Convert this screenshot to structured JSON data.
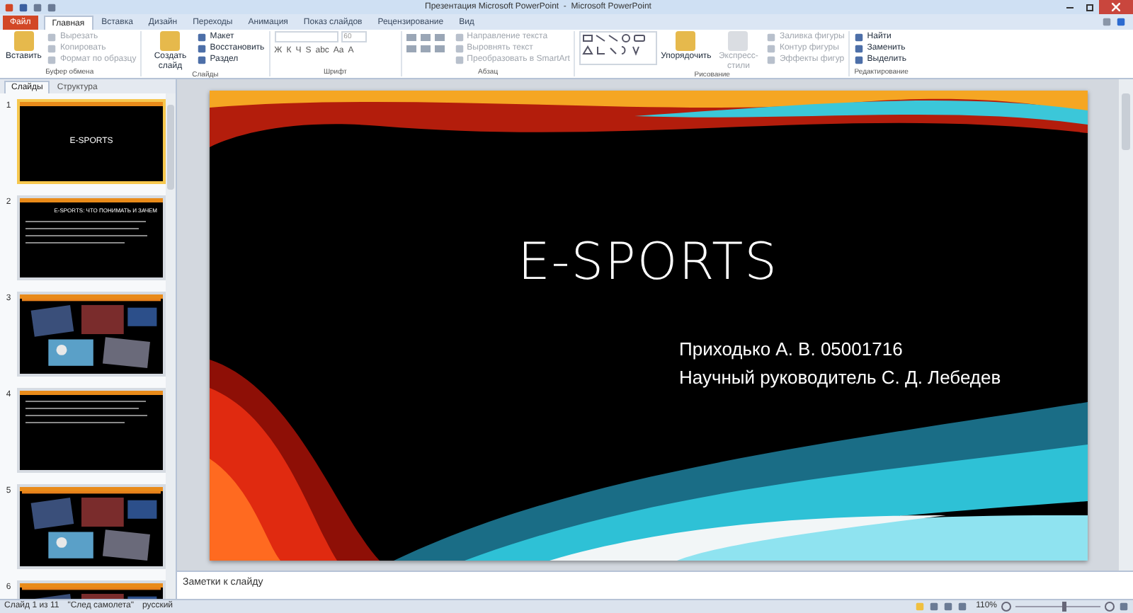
{
  "window": {
    "title": "Презентация Microsoft PowerPoint  -  Microsoft PowerPoint"
  },
  "tabs": [
    {
      "label": "Файл",
      "kind": "file",
      "selected": false
    },
    {
      "label": "Главная",
      "kind": "tab",
      "selected": true
    },
    {
      "label": "Вставка",
      "kind": "tab",
      "selected": false
    },
    {
      "label": "Дизайн",
      "kind": "tab",
      "selected": false
    },
    {
      "label": "Переходы",
      "kind": "tab",
      "selected": false
    },
    {
      "label": "Анимация",
      "kind": "tab",
      "selected": false
    },
    {
      "label": "Показ слайдов",
      "kind": "tab",
      "selected": false
    },
    {
      "label": "Рецензирование",
      "kind": "tab",
      "selected": false
    },
    {
      "label": "Вид",
      "kind": "tab",
      "selected": false
    }
  ],
  "ribbon": {
    "groups": [
      {
        "label": "Буфер обмена",
        "big": {
          "label": "Вставить",
          "disabled": false
        },
        "items": [
          {
            "label": "Вырезать",
            "disabled": true
          },
          {
            "label": "Копировать",
            "disabled": true
          },
          {
            "label": "Формат по образцу",
            "disabled": true
          }
        ]
      },
      {
        "label": "Слайды",
        "big": {
          "label": "Создать слайд",
          "disabled": false
        },
        "items": [
          {
            "label": "Макет",
            "disabled": false
          },
          {
            "label": "Восстановить",
            "disabled": false
          },
          {
            "label": "Раздел",
            "disabled": false
          }
        ]
      },
      {
        "label": "Шрифт",
        "font_size": "60",
        "format_buttons": [
          "Ж",
          "К",
          "Ч",
          "S",
          "abc",
          "Aa",
          "A"
        ]
      },
      {
        "label": "Абзац",
        "items": [
          {
            "label": "Направление текста",
            "disabled": true
          },
          {
            "label": "Выровнять текст",
            "disabled": true
          },
          {
            "label": "Преобразовать в SmartArt",
            "disabled": true
          }
        ]
      },
      {
        "label": "Рисование",
        "big": {
          "label": "Упорядочить",
          "disabled": false
        },
        "big2": {
          "label": "Экспресс-стили",
          "disabled": true
        },
        "items": [
          {
            "label": "Заливка фигуры",
            "disabled": true
          },
          {
            "label": "Контур фигуры",
            "disabled": true
          },
          {
            "label": "Эффекты фигур",
            "disabled": true
          }
        ]
      },
      {
        "label": "Редактирование",
        "items": [
          {
            "label": "Найти",
            "disabled": false
          },
          {
            "label": "Заменить",
            "disabled": false
          },
          {
            "label": "Выделить",
            "disabled": false
          }
        ]
      }
    ]
  },
  "panel": {
    "tabs": [
      {
        "label": "Слайды",
        "selected": true
      },
      {
        "label": "Структура",
        "selected": false
      }
    ],
    "thumbnails": [
      {
        "number": "1",
        "kind": "title",
        "title": "E-SPORTS",
        "selected": true
      },
      {
        "number": "2",
        "kind": "bullets",
        "title": "E-SPORTS: ЧТО ПОНИМАТЬ И ЗАЧЕМ",
        "selected": false
      },
      {
        "number": "3",
        "kind": "photos",
        "selected": false
      },
      {
        "number": "4",
        "kind": "bullets",
        "selected": false
      },
      {
        "number": "5",
        "kind": "photos",
        "selected": false
      },
      {
        "number": "6",
        "kind": "photos",
        "selected": false
      }
    ]
  },
  "slide": {
    "title": "E-SPORTS",
    "subtitle": [
      "Приходько А. В. 05001716",
      "Научный руководитель С. Д. Лебедев"
    ]
  },
  "notes": {
    "placeholder": "Заметки к слайду"
  },
  "status_bar": {
    "slide": "Слайд 1 из 11",
    "theme": "\"След самолета\"",
    "language": "русский",
    "zoom": "110%",
    "zoom_slider": {
      "level": 0.55
    }
  }
}
